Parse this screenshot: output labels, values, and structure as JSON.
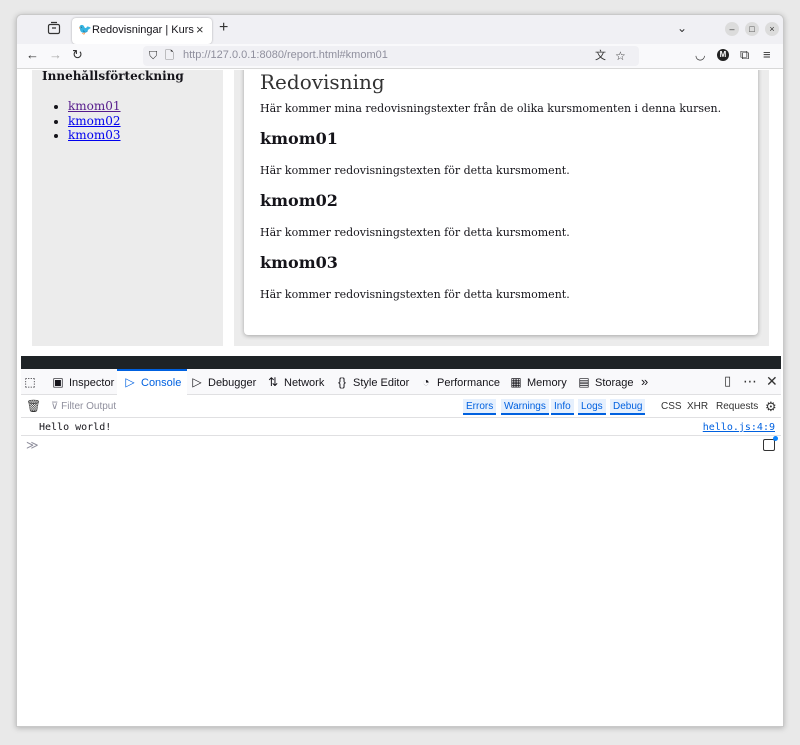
{
  "browser": {
    "tab_title": "Redovisningar | Kursen w",
    "tab_favicon": "bird-favicon-icon",
    "new_tab_label": "+",
    "url_prefix": "http://",
    "url_host": "127.0.0.1",
    "url_rest": ":8080/report.html#kmom01"
  },
  "page": {
    "sidebar": {
      "heading": "Innehållsförteckning",
      "links": [
        "kmom01",
        "kmom02",
        "kmom03"
      ]
    },
    "main": {
      "title": "Redovisning",
      "intro": "Här kommer mina redovisningstexter från de olika kursmomenten i denna kursen.",
      "sections": [
        {
          "heading": "kmom01",
          "text": "Här kommer redovisningstexten för detta kursmoment."
        },
        {
          "heading": "kmom02",
          "text": "Här kommer redovisningstexten för detta kursmoment."
        },
        {
          "heading": "kmom03",
          "text": "Här kommer redovisningstexten för detta kursmoment."
        }
      ]
    }
  },
  "devtools": {
    "tabs": [
      "Inspector",
      "Console",
      "Debugger",
      "Network",
      "Style Editor",
      "Performance",
      "Memory",
      "Storage"
    ],
    "active_tab": "Console",
    "filter_placeholder": "Filter Output",
    "level_filters": [
      "Errors",
      "Warnings",
      "Info",
      "Logs",
      "Debug"
    ],
    "request_filters": [
      "CSS",
      "XHR",
      "Requests"
    ],
    "messages": [
      {
        "text": "Hello world!",
        "source": "hello.js:4:9"
      }
    ]
  }
}
